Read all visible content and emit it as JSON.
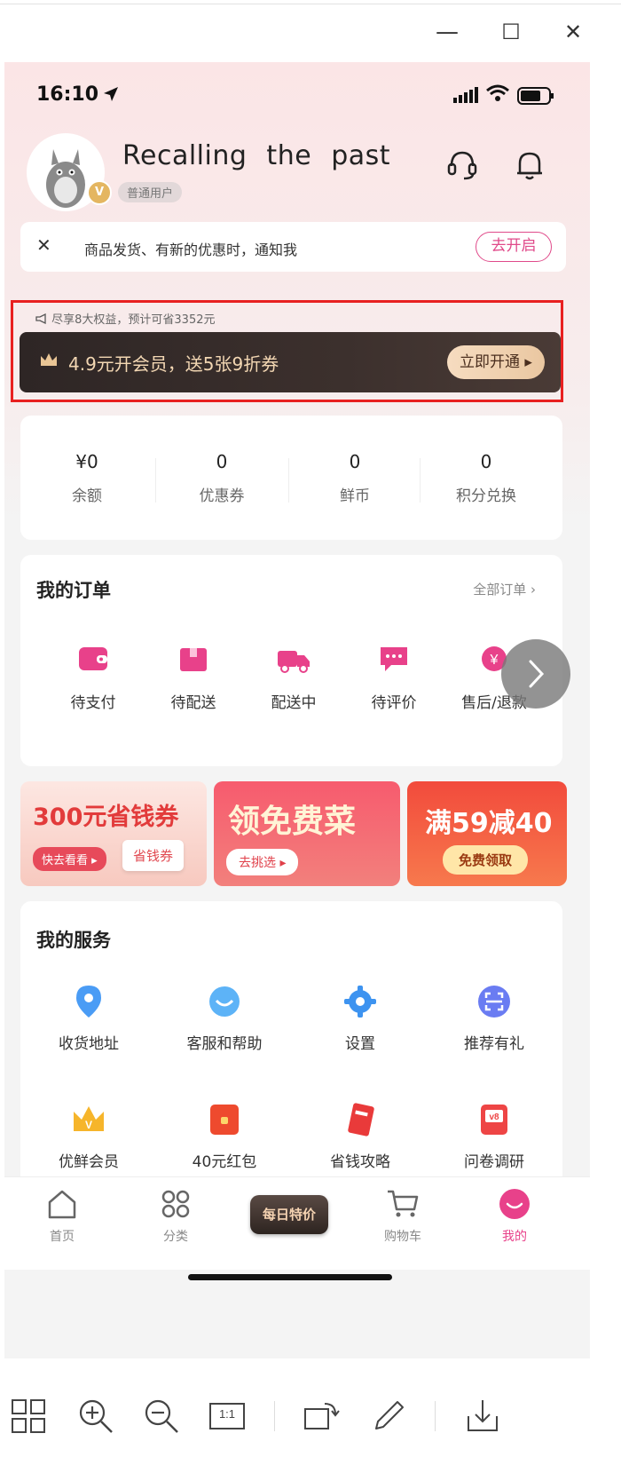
{
  "window_controls": {
    "minimize": "—",
    "maximize": "☐",
    "close": "✕"
  },
  "status_bar": {
    "time": "16:10"
  },
  "profile": {
    "username": "Recalling  the  past",
    "level": "普通用户",
    "vip_badge": "V"
  },
  "notification": {
    "close": "✕",
    "text": "商品发货、有新的优惠时，通知我",
    "button": "去开启"
  },
  "vip_promo": {
    "tip": "尽享8大权益，预计可省3352元",
    "text": "4.9元开会员，送5张9折券",
    "button": "立即开通 ▸"
  },
  "wallet": [
    {
      "value": "¥0",
      "label": "余额"
    },
    {
      "value": "0",
      "label": "优惠券"
    },
    {
      "value": "0",
      "label": "鲜币"
    },
    {
      "value": "0",
      "label": "积分兑换"
    }
  ],
  "orders": {
    "title": "我的订单",
    "all": "全部订单 ›",
    "items": [
      {
        "label": "待支付",
        "icon": "wallet-icon"
      },
      {
        "label": "待配送",
        "icon": "package-icon"
      },
      {
        "label": "配送中",
        "icon": "delivery-truck-icon"
      },
      {
        "label": "待评价",
        "icon": "comment-icon"
      },
      {
        "label": "售后/退款",
        "icon": "refund-icon"
      }
    ]
  },
  "banners": [
    {
      "title": "300元省钱券",
      "sub1": "快去看看 ▸",
      "sub2": "省钱券"
    },
    {
      "title": "领免费菜",
      "sub1": "去挑选 ▸"
    },
    {
      "title": "满59减40",
      "sub1": "免费领取"
    }
  ],
  "services": {
    "title": "我的服务",
    "items": [
      {
        "label": "收货地址",
        "icon": "location-pin-icon"
      },
      {
        "label": "客服和帮助",
        "icon": "customer-service-icon"
      },
      {
        "label": "设置",
        "icon": "settings-gear-icon"
      },
      {
        "label": "推荐有礼",
        "icon": "scan-icon"
      },
      {
        "label": "优鲜会员",
        "icon": "crown-icon"
      },
      {
        "label": "40元红包",
        "icon": "red-packet-icon"
      },
      {
        "label": "省钱攻略",
        "icon": "coupon-guide-icon"
      },
      {
        "label": "问卷调研",
        "icon": "survey-icon"
      }
    ]
  },
  "tabbar": {
    "items": [
      {
        "label": "首页",
        "icon": "home-icon"
      },
      {
        "label": "分类",
        "icon": "category-grid-icon"
      },
      {
        "label": "购物车",
        "icon": "cart-icon"
      },
      {
        "label": "我的",
        "icon": "profile-face-icon"
      }
    ],
    "special": "每日特价",
    "active_index": 3
  },
  "viewer_toolbar": {
    "zoom_actual": "1:1",
    "tools": [
      "thumbnails-icon",
      "zoom-in-icon",
      "zoom-out-icon",
      "actual-size-icon",
      "rotate-icon",
      "edit-pen-icon",
      "download-icon"
    ]
  },
  "colors": {
    "accent": "#e8418a",
    "vip_bg": "#2e2625",
    "vip_text": "#f3d7b3",
    "highlight_border": "#e82020"
  }
}
